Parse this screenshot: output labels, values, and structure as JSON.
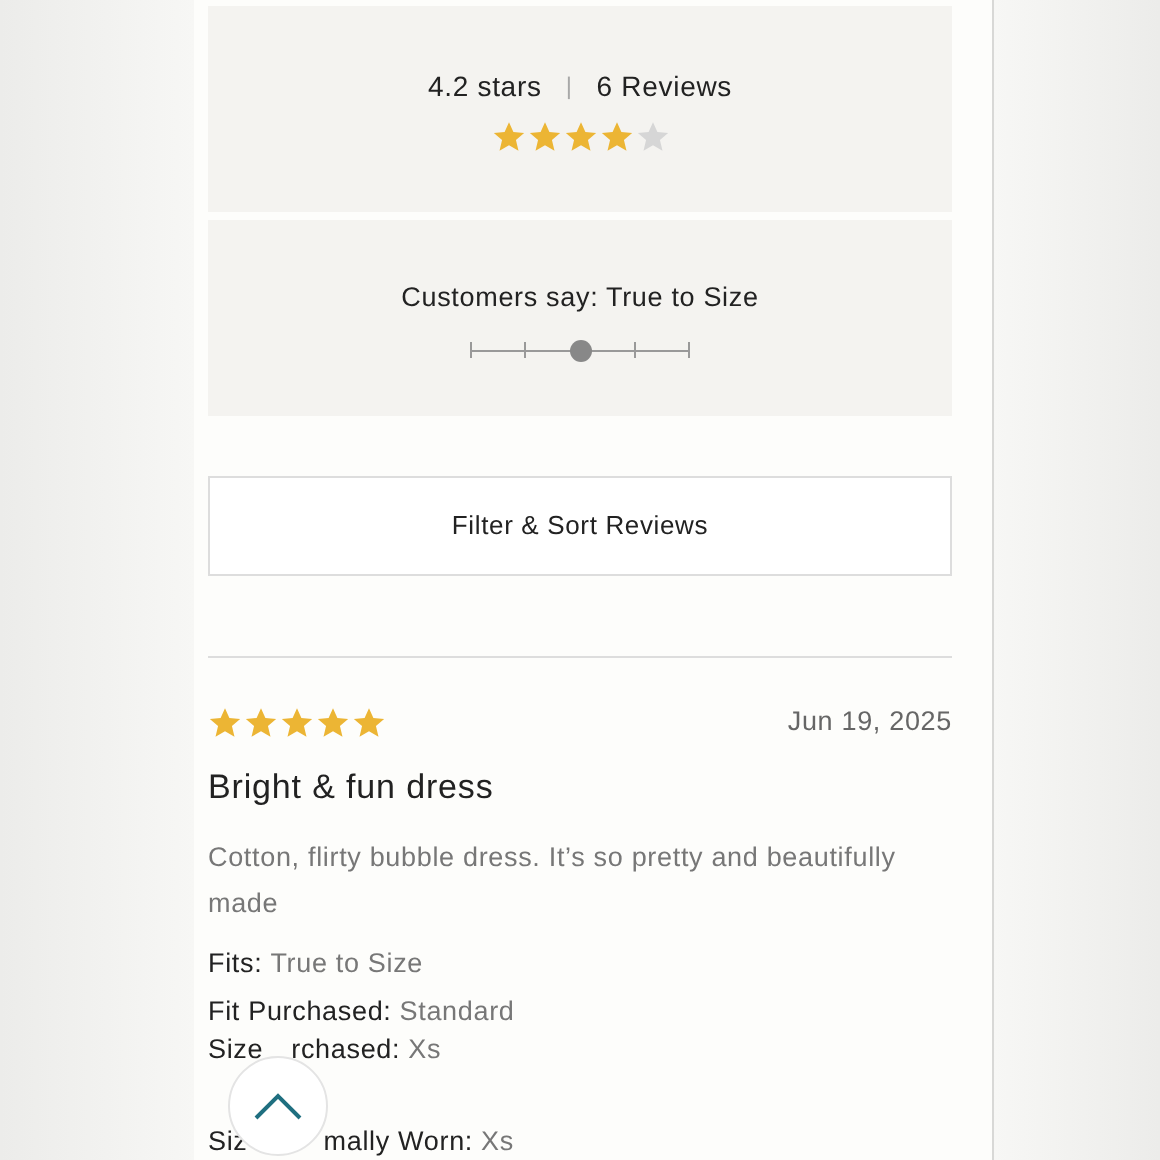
{
  "summary": {
    "rating_text": "4.2 stars",
    "separator": "|",
    "reviews_count": "6 Reviews",
    "stars": 4
  },
  "fit": {
    "label": "Customers say: True to Size",
    "level": 0.5
  },
  "filter_button": "Filter & Sort Reviews",
  "review": {
    "stars": 5,
    "date": "Jun 19, 2025",
    "title": "Bright & fun dress",
    "body": "Cotton, flirty bubble dress. It’s so pretty and beautifully made",
    "details": [
      {
        "label": "Fits:",
        "value": "True to Size"
      },
      {
        "label": "Fit Purchased:",
        "value": "Standard"
      },
      {
        "label_parts": [
          "Size",
          "rchased:"
        ],
        "value": "Xs"
      },
      {
        "label_parts": [
          "Siz",
          "mally Worn:"
        ],
        "value": "Xs"
      }
    ]
  }
}
